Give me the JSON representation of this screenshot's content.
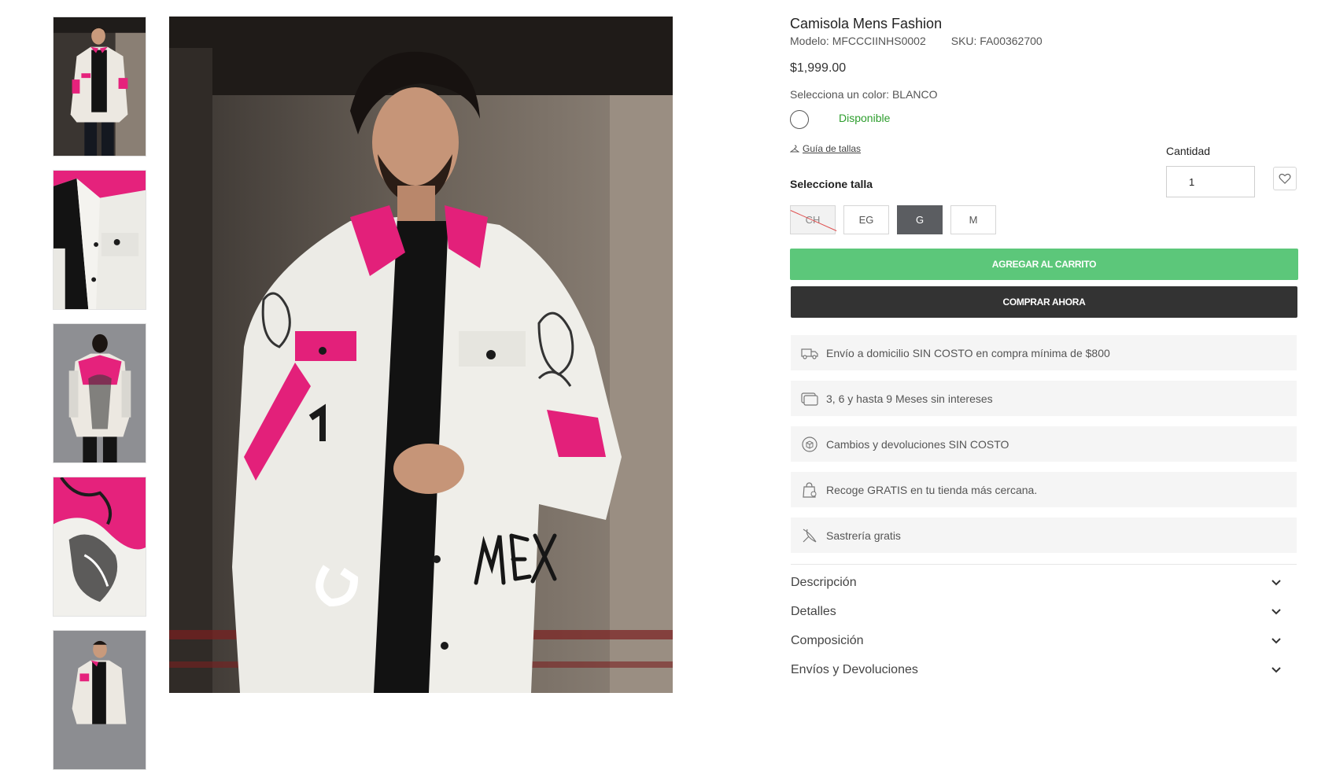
{
  "product": {
    "title": "Camisola Mens Fashion",
    "model": "Modelo: MFCCCIINHS0002",
    "sku": "SKU: FA00362700",
    "price": "$1,999.00",
    "color_label": "Selecciona un color: BLANCO",
    "availability": "Disponible",
    "availability_color": "#2e9e2e",
    "size_guide": "Guía de tallas",
    "size_label": "Seleccione talla",
    "quantity_label": "Cantidad",
    "quantity_value": "1",
    "sizes": [
      {
        "label": "CH",
        "state": "unavailable"
      },
      {
        "label": "EG",
        "state": "available"
      },
      {
        "label": "G",
        "state": "selected"
      },
      {
        "label": "M",
        "state": "available"
      }
    ]
  },
  "actions": {
    "add_to_cart": "AGREGAR AL CARRITO",
    "buy_now": "COMPRAR AHORA",
    "add_to_cart_color": "#5cc77a",
    "buy_now_color": "#333333"
  },
  "benefits": [
    {
      "icon": "truck-icon",
      "text": "Envío a domicilio SIN COSTO en compra mínima de $800"
    },
    {
      "icon": "credit-card-icon",
      "text": "3, 6 y hasta 9 Meses sin intereses"
    },
    {
      "icon": "box-return-icon",
      "text": "Cambios y devoluciones SIN COSTO"
    },
    {
      "icon": "store-pickup-icon",
      "text": "Recoge GRATIS en tu tienda más cercana."
    },
    {
      "icon": "tailoring-icon",
      "text": "Sastrería gratis"
    }
  ],
  "accordions": [
    {
      "label": "Descripción"
    },
    {
      "label": "Detalles"
    },
    {
      "label": "Composición"
    },
    {
      "label": "Envíos y Devoluciones"
    }
  ],
  "gallery": {
    "thumbnail_count": 5,
    "selected_index": 0
  }
}
